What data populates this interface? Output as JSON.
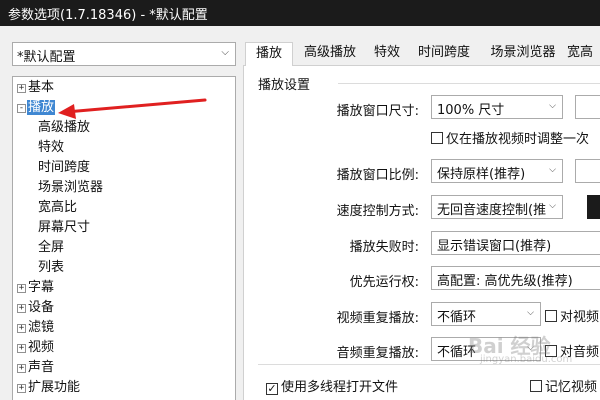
{
  "window": {
    "title": "参数选项(1.7.18346) - *默认配置"
  },
  "preset": {
    "value": "*默认配置"
  },
  "tree": [
    {
      "label": "基本",
      "expander": "+",
      "selected": false
    },
    {
      "label": "播放",
      "expander": "-",
      "selected": true
    },
    {
      "label": "高级播放"
    },
    {
      "label": "特效"
    },
    {
      "label": "时间跨度"
    },
    {
      "label": "场景浏览器"
    },
    {
      "label": "宽高比"
    },
    {
      "label": "屏幕尺寸"
    },
    {
      "label": "全屏"
    },
    {
      "label": "列表"
    },
    {
      "label": "字幕",
      "expander": "+"
    },
    {
      "label": "设备",
      "expander": "+"
    },
    {
      "label": "滤镜",
      "expander": "+"
    },
    {
      "label": "视频",
      "expander": "+"
    },
    {
      "label": "声音",
      "expander": "+"
    },
    {
      "label": "扩展功能",
      "expander": "+"
    }
  ],
  "tabs": [
    "播放",
    "高级播放",
    "特效",
    "时间跨度",
    "场景浏览器",
    "宽高"
  ],
  "section": {
    "title": "播放设置"
  },
  "settings": {
    "window_size": {
      "label": "播放窗口尺寸:",
      "value": "100% 尺寸"
    },
    "adjust_only_video": {
      "label": "仅在播放视频时调整一次",
      "checked": false
    },
    "window_ratio": {
      "label": "播放窗口比例:",
      "value": "保持原样(推荐)"
    },
    "speed_control": {
      "label": "速度控制方式:",
      "value": "无回音速度控制(推"
    },
    "on_fail": {
      "label": "播放失败时:",
      "value": "显示错误窗口(推荐)"
    },
    "priority": {
      "label": "优先运行权:",
      "value": "高配置: 高优先级(推荐)"
    },
    "video_repeat": {
      "label": "视频重复播放:",
      "value": "不循环",
      "check_label": "对视频"
    },
    "audio_repeat": {
      "label": "音频重复播放:",
      "value": "不循环",
      "check_label": "对音频"
    },
    "multithread": {
      "label": "使用多线程打开文件",
      "checked": true
    },
    "remember_video": {
      "label": "记忆视频",
      "checked": false
    }
  },
  "watermark": {
    "text": "Bai 经验",
    "sub": "jingyan.baidu.com"
  },
  "colors": {
    "selection": "#3f87d2",
    "arrow": "#e02020",
    "titlebar": "#1b1b1b"
  }
}
